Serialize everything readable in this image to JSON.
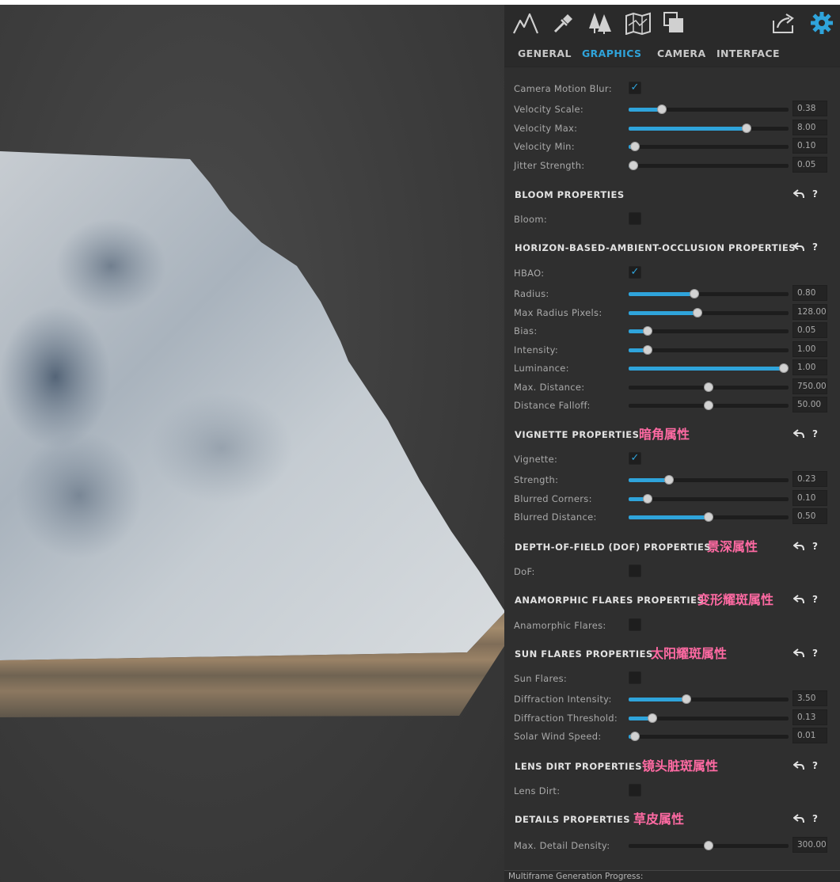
{
  "colors": {
    "accent": "#2fa4db",
    "annotation": "#ff6aa3",
    "panel_bg": "#2f2f2f"
  },
  "toolbar": {
    "icons": [
      "mountain-icon",
      "eyedropper-icon",
      "trees-icon",
      "map-icon",
      "layers-icon",
      "share-icon",
      "gear-icon"
    ]
  },
  "tabs": [
    {
      "label": "GENERAL",
      "active": false
    },
    {
      "label": "GRAPHICS",
      "active": true
    },
    {
      "label": "CAMERA",
      "active": false
    },
    {
      "label": "INTERFACE",
      "active": false
    }
  ],
  "motion_blur": {
    "enabled_label": "Camera Motion Blur:",
    "enabled": true,
    "sliders": [
      {
        "label": "Velocity Scale:",
        "value": "0.38",
        "fraction": 0.21
      },
      {
        "label": "Velocity Max:",
        "value": "8.00",
        "fraction": 0.74
      },
      {
        "label": "Velocity Min:",
        "value": "0.10",
        "fraction": 0.04
      },
      {
        "label": "Jitter Strength:",
        "value": "0.05",
        "fraction": 0.03
      }
    ]
  },
  "sections": [
    {
      "title": "BLOOM PROPERTIES",
      "annotation": "",
      "toggle": {
        "label": "Bloom:",
        "checked": false
      },
      "sliders": []
    },
    {
      "title": "HORIZON-BASED-AMBIENT-OCCLUSION PROPERTIES",
      "annotation": "",
      "toggle": {
        "label": "HBAO:",
        "checked": true
      },
      "sliders": [
        {
          "label": "Radius:",
          "value": "0.80",
          "fraction": 0.41,
          "filled": true
        },
        {
          "label": "Max Radius Pixels:",
          "value": "128.00",
          "fraction": 0.43,
          "filled": true
        },
        {
          "label": "Bias:",
          "value": "0.05",
          "fraction": 0.12,
          "filled": true
        },
        {
          "label": "Intensity:",
          "value": "1.00",
          "fraction": 0.12,
          "filled": true
        },
        {
          "label": "Luminance:",
          "value": "1.00",
          "fraction": 0.97,
          "filled": true
        },
        {
          "label": "Max. Distance:",
          "value": "750.00",
          "fraction": 0.5,
          "filled": false
        },
        {
          "label": "Distance Falloff:",
          "value": "50.00",
          "fraction": 0.5,
          "filled": false
        }
      ]
    },
    {
      "title": "VIGNETTE PROPERTIES",
      "annotation": "暗角属性",
      "toggle": {
        "label": "Vignette:",
        "checked": true
      },
      "sliders": [
        {
          "label": "Strength:",
          "value": "0.23",
          "fraction": 0.25,
          "filled": true
        },
        {
          "label": "Blurred Corners:",
          "value": "0.10",
          "fraction": 0.12,
          "filled": true
        },
        {
          "label": "Blurred Distance:",
          "value": "0.50",
          "fraction": 0.5,
          "filled": true
        }
      ]
    },
    {
      "title": "DEPTH-OF-FIELD (DOF)  PROPERTIES",
      "annotation": "景深属性",
      "toggle": {
        "label": "DoF:",
        "checked": false
      },
      "sliders": []
    },
    {
      "title": "ANAMORPHIC FLARES PROPERTIES",
      "annotation": "变形耀斑属性",
      "toggle": {
        "label": "Anamorphic Flares:",
        "checked": false
      },
      "sliders": []
    },
    {
      "title": "SUN FLARES PROPERTIES",
      "annotation": "太阳耀斑属性",
      "toggle": {
        "label": "Sun Flares:",
        "checked": false
      },
      "sliders": [
        {
          "label": "Diffraction Intensity:",
          "value": "3.50",
          "fraction": 0.36,
          "filled": true
        },
        {
          "label": "Diffraction Threshold:",
          "value": "0.13",
          "fraction": 0.15,
          "filled": true
        },
        {
          "label": "Solar Wind Speed:",
          "value": "0.01",
          "fraction": 0.04,
          "filled": true
        }
      ]
    },
    {
      "title": "LENS DIRT PROPERTIES",
      "annotation": "镜头脏斑属性",
      "toggle": {
        "label": "Lens Dirt:",
        "checked": false
      },
      "sliders": []
    },
    {
      "title": "DETAILS PROPERTIES",
      "annotation": "草皮属性",
      "toggle": null,
      "sliders": [
        {
          "label": "Max. Detail Density:",
          "value": "300.00",
          "fraction": 0.5,
          "filled": false
        }
      ]
    }
  ],
  "status": {
    "text": "Multiframe Generation Progress:"
  }
}
